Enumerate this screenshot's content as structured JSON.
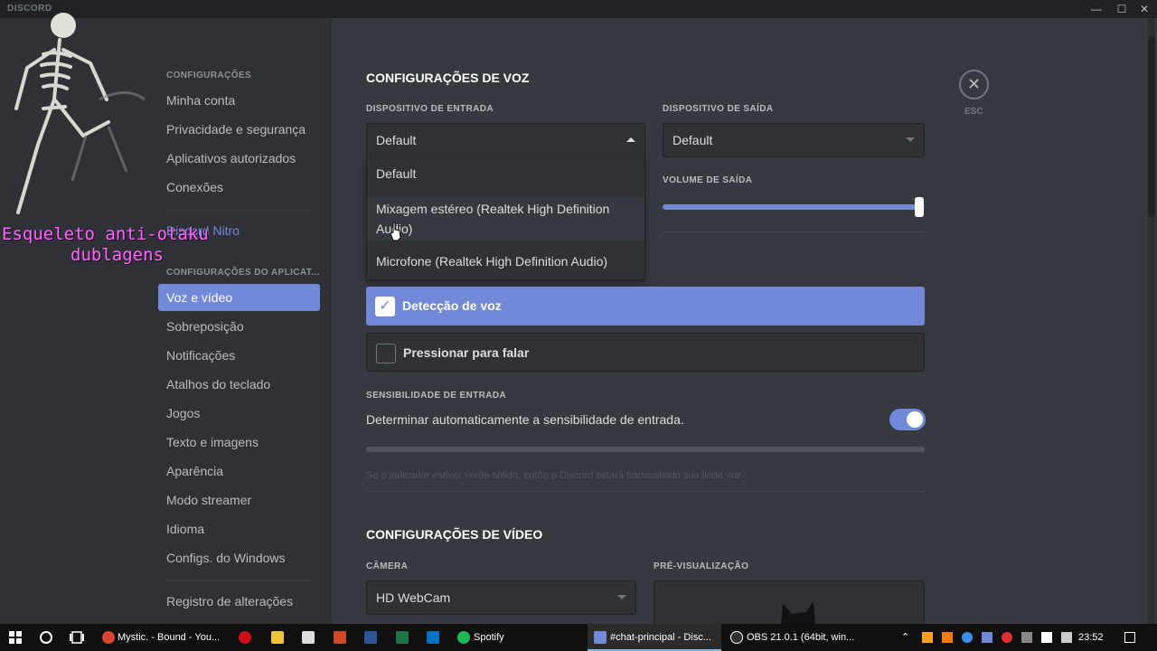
{
  "titlebar": {
    "brand": "DISCORD",
    "minimize": "—",
    "maximize": "☐",
    "close": "✕"
  },
  "overlay": {
    "line1": "Esqueleto anti-otaku",
    "line2": "dublagens"
  },
  "sidebar": {
    "section1": "CONFIGURAÇÕES",
    "items1": [
      "Minha conta",
      "Privacidade e segurança",
      "Aplicativos autorizados",
      "Conexões"
    ],
    "nitro": "Discord Nitro",
    "section2": "CONFIGURAÇÕES DO APLICAT...",
    "items2": [
      "Voz e vídeo",
      "Sobreposição",
      "Notificações",
      "Atalhos do teclado",
      "Jogos",
      "Texto e imagens",
      "Aparência",
      "Modo streamer",
      "Idioma",
      "Configs. do Windows"
    ],
    "changelog": "Registro de alterações"
  },
  "voice": {
    "title": "CONFIGURAÇÕES DE VOZ",
    "input_label": "DISPOSITIVO DE ENTRADA",
    "input_value": "Default",
    "input_options": [
      "Default",
      "Mixagem estéreo (Realtek High Definition Audio)",
      "Microfone (Realtek High Definition Audio)"
    ],
    "output_label": "DISPOSITIVO DE SAÍDA",
    "output_value": "Default",
    "output_volume_label": "VOLUME DE SAÍDA",
    "output_volume": 0.98,
    "mode_voice": "Detecção de voz",
    "mode_voice_selected": true,
    "mode_ptt": "Pressionar para falar",
    "sensitivity_label": "SENSIBILIDADE DE ENTRADA",
    "auto_sensitivity": "Determinar automaticamente a sensibilidade de entrada.",
    "auto_sensitivity_on": true,
    "sensitivity_hint": "Se o indicador estiver verde sólido, então o Discord estará transmitindo sua linda voz."
  },
  "video": {
    "title": "CONFIGURAÇÕES DE VÍDEO",
    "camera_label": "CÂMERA",
    "camera_value": "HD WebCam",
    "preview_label": "PRÉ-VISUALIZAÇÃO"
  },
  "esc": {
    "icon": "✕",
    "label": "ESC"
  },
  "taskbar": {
    "apps": [
      "Mystic. - Bound - You...",
      "Spotify",
      "#chat-principal - Disc...",
      "OBS 21.0.1 (64bit, win..."
    ],
    "time": "23:52",
    "colors": {
      "accent": "#7289da",
      "background": "#36393f",
      "sidebar": "#2f3136"
    }
  }
}
